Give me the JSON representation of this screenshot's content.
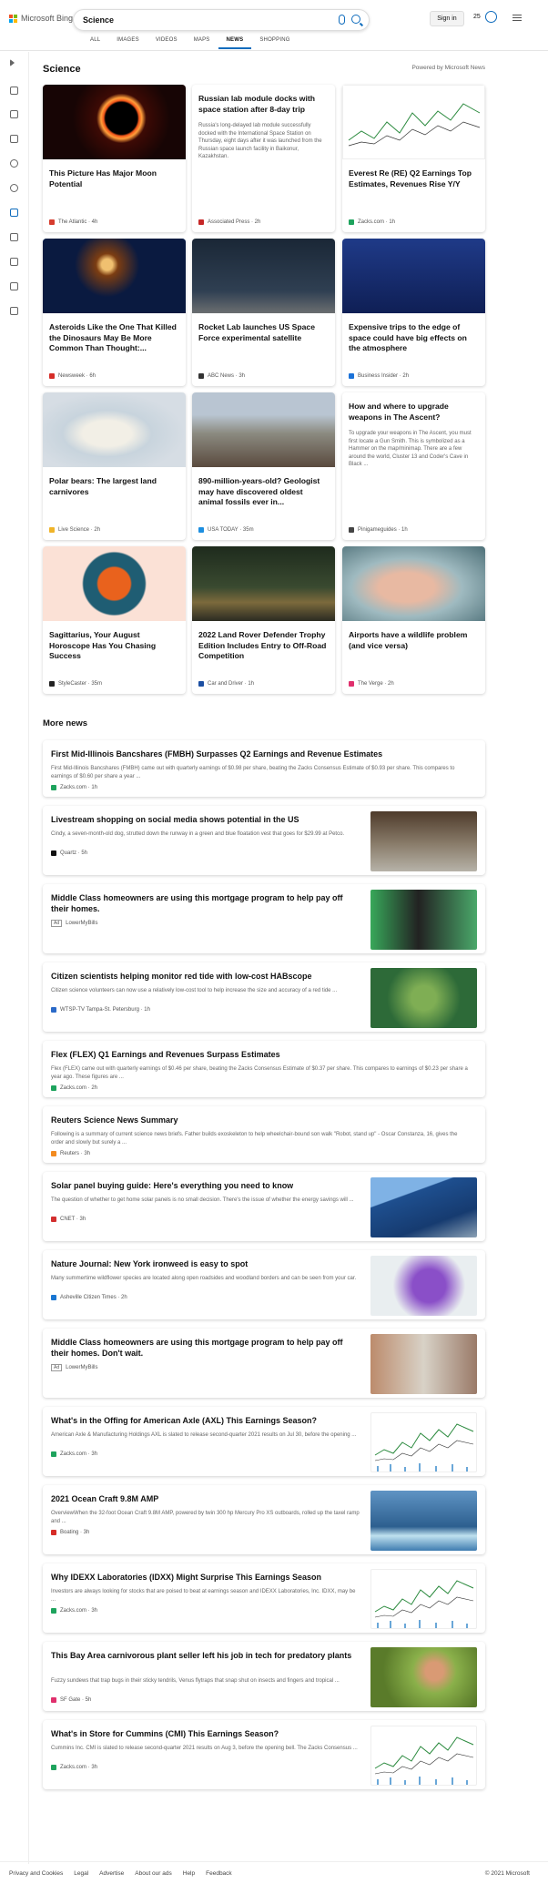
{
  "header": {
    "brand": "Microsoft Bing",
    "query": "Science",
    "sign_in": "Sign in",
    "points": "25"
  },
  "tabs": [
    "ALL",
    "IMAGES",
    "VIDEOS",
    "MAPS",
    "NEWS",
    "SHOPPING"
  ],
  "section": {
    "title": "Science",
    "powered": "Powered by Microsoft News"
  },
  "cards": [
    {
      "title": "This Picture Has Major Moon Potential",
      "source": "The Atlantic · 4h",
      "color": "#d63c2e",
      "img": "moon"
    },
    {
      "title": "Russian lab module docks with space station after 8-day trip",
      "summary": "Russia's long-delayed lab module successfully docked with the International Space Station on Thursday, eight days after it was launched from the Russian space launch facility in Baikonur, Kazakhstan.",
      "source": "Associated Press · 2h",
      "color": "#c62828"
    },
    {
      "title": "Everest Re (RE) Q2 Earnings Top Estimates, Revenues Rise Y/Y",
      "source": "Zacks.com · 1h",
      "color": "#1ea35d",
      "img": "chart"
    },
    {
      "title": "Asteroids Like the One That Killed the Dinosaurs May Be More Common Than Thought:...",
      "source": "Newsweek · 6h",
      "color": "#d62d28",
      "img": "asteroid"
    },
    {
      "title": "Rocket Lab launches US Space Force experimental satellite",
      "source": "ABC News · 3h",
      "color": "#333",
      "img": "rocket"
    },
    {
      "title": "Expensive trips to the edge of space could have big effects on the atmosphere",
      "source": "Business Insider · 2h",
      "color": "#1b72d8",
      "img": "crew"
    },
    {
      "title": "Polar bears: The largest land carnivores",
      "source": "Live Science · 2h",
      "color": "#f0b429",
      "img": "bear"
    },
    {
      "title": "890-million-years-old? Geologist may have discovered oldest animal fossils ever in...",
      "source": "USA TODAY · 35m",
      "color": "#1d8fe0",
      "img": "geo"
    },
    {
      "title": "How and where to upgrade weapons in The Ascent?",
      "summary": "To upgrade your weapons in The Ascent, you must first locate a Gun Smith. This is symbolized as a Hammer on the map/minimap. There are a few around the world, Cluster 13 and Coder's Cave in Black ...",
      "source": "Pinigameguides · 1h",
      "color": "#444"
    },
    {
      "title": "Sagittarius, Your August Horoscope Has You Chasing Success",
      "source": "StyleCaster · 35m",
      "color": "#222",
      "img": "sag"
    },
    {
      "title": "2022 Land Rover Defender Trophy Edition Includes Entry to Off-Road Competition",
      "source": "Car and Driver · 1h",
      "color": "#1c4fa2",
      "img": "car"
    },
    {
      "title": "Airports have a wildlife problem (and vice versa)",
      "source": "The Verge · 2h",
      "color": "#e0306d",
      "img": "face"
    }
  ],
  "more_news_title": "More news",
  "news": [
    {
      "title": "First Mid-Illinois Bancshares (FMBH) Surpasses Q2 Earnings and Revenue Estimates",
      "summary": "First Mid-Illinois Bancshares (FMBH) came out with quarterly earnings of $0.98 per share, beating the Zacks Consensus Estimate of $0.93 per share. This compares to earnings of $0.60 per share a year ...",
      "source": "Zacks.com · 1h",
      "color": "#1ea35d"
    },
    {
      "title": "Livestream shopping on social media shows potential in the US",
      "summary": "Cindy, a seven-month-old dog, strutted down the runway in a green and blue floatation vest that goes for $29.99 at Petco.",
      "source": "Quartz · 5h",
      "color": "#111",
      "thumb": "dog"
    },
    {
      "title": "Middle Class homeowners are using this mortgage program to help pay off their homes.",
      "source": "Ad · LowerMyBills",
      "color": "#fff",
      "thumb": "ad1"
    },
    {
      "title": "Citizen scientists helping monitor red tide with low-cost HABscope",
      "summary": "Citizen science volunteers can now use a relatively low-cost tool to help increase the size and accuracy of a red tide ...",
      "source": "WTSP-TV Tampa-St. Petersburg · 1h",
      "color": "#2b6ac8",
      "thumb": "tide"
    },
    {
      "title": "Flex (FLEX) Q1 Earnings and Revenues Surpass Estimates",
      "summary": "Flex (FLEX) came out with quarterly earnings of $0.46 per share, beating the Zacks Consensus Estimate of $0.37 per share. This compares to earnings of $0.23 per share a year ago. These figures are ...",
      "source": "Zacks.com · 2h",
      "color": "#1ea35d"
    },
    {
      "title": "Reuters Science News Summary",
      "summary": "Following is a summary of current science news briefs. Father builds exoskeleton to help wheelchair-bound son walk \"Robot, stand up\" - Oscar Constanza, 16, gives the order and slowly but surely a ...",
      "source": "Reuters · 3h",
      "color": "#f28b20"
    },
    {
      "title": "Solar panel buying guide: Here's everything you need to know",
      "summary": "The question of whether to get home solar panels is no small decision. There's the issue of whether the energy savings will ...",
      "source": "CNET · 3h",
      "color": "#d32f2f",
      "thumb": "solar"
    },
    {
      "title": "Nature Journal: New York ironweed is easy to spot",
      "summary": "Many summertime wildflower species are located along open roadsides and woodland borders and can be seen from your car.",
      "source": "Asheville Citizen Times · 2h",
      "color": "#1976d2",
      "thumb": "flower"
    },
    {
      "title": "Middle Class homeowners are using this mortgage program to help pay off their homes. Don't wait.",
      "source": "Ad · LowerMyBills",
      "color": "#fff",
      "thumb": "ad2"
    },
    {
      "title": "What's in the Offing for American Axle (AXL) This Earnings Season?",
      "summary": "American Axle & Manufacturing Holdings AXL is slated to release second-quarter 2021 results on Jul 30, before the opening ...",
      "source": "Zacks.com · 3h",
      "color": "#1ea35d",
      "thumb": "chart"
    },
    {
      "title": "2021 Ocean Craft 9.8M AMP",
      "summary": "OverviewWhen the 32-foot Ocean Craft 9.8M AMP, powered by twin 300 hp Mercury Pro XS outboards, rolled up the taxel ramp and ...",
      "source": "Boating · 3h",
      "color": "#d62d28",
      "thumb": "boat"
    },
    {
      "title": "Why IDEXX Laboratories (IDXX) Might Surprise This Earnings Season",
      "summary": "Investors are always looking for stocks that are poised to beat at earnings season and IDEXX Laboratories, Inc. IDXX, may be ...",
      "source": "Zacks.com · 3h",
      "color": "#1ea35d",
      "thumb": "chart"
    },
    {
      "title": "This Bay Area carnivorous plant seller left his job in tech for predatory plants",
      "summary": "Fuzzy sundews that trap bugs in their sticky tendrils, Venus flytraps that snap shut on insects and fingers and tropical ...",
      "source": "SF Gate · 5h",
      "color": "#e0306d",
      "thumb": "plant"
    },
    {
      "title": "What's in Store for Cummins (CMI) This Earnings Season?",
      "summary": "Cummins Inc. CMI is slated to release second-quarter 2021 results on Aug 3, before the opening bell. The Zacks Consensus ...",
      "source": "Zacks.com · 3h",
      "color": "#1ea35d",
      "thumb": "chart"
    }
  ],
  "footer": {
    "links": [
      "Privacy and Cookies",
      "Legal",
      "Advertise",
      "About our ads",
      "Help",
      "Feedback"
    ],
    "copyright": "© 2021 Microsoft"
  }
}
